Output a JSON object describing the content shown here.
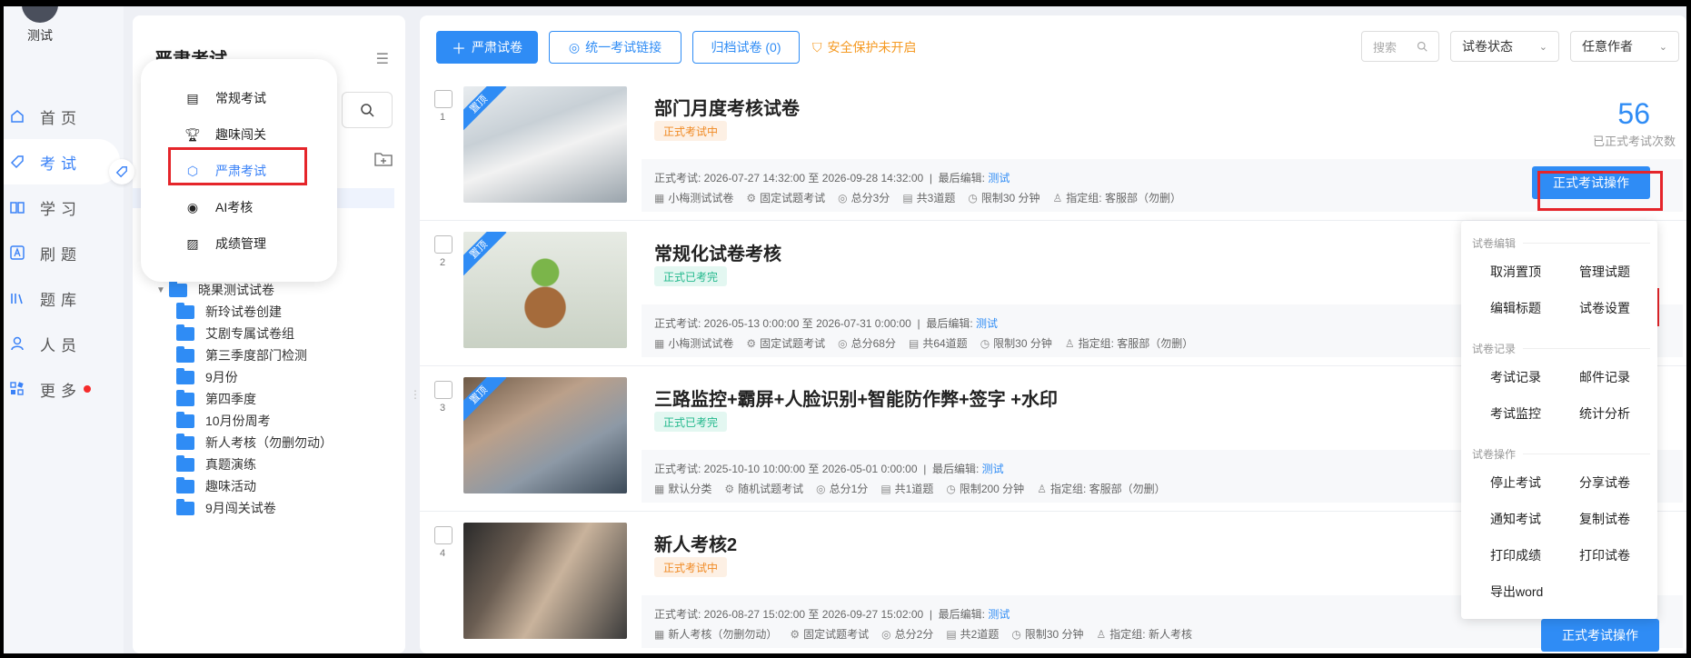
{
  "user": {
    "name": "测试"
  },
  "nav": {
    "items": [
      {
        "key": "home",
        "label": "首页",
        "icon": "home-icon"
      },
      {
        "key": "exam",
        "label": "考试",
        "icon": "tag-icon",
        "active": true
      },
      {
        "key": "study",
        "label": "学习",
        "icon": "book-icon"
      },
      {
        "key": "practice",
        "label": "刷题",
        "icon": "a-box-icon"
      },
      {
        "key": "bank",
        "label": "题库",
        "icon": "library-icon"
      },
      {
        "key": "people",
        "label": "人员",
        "icon": "user-icon"
      },
      {
        "key": "more",
        "label": "更多",
        "icon": "apps-icon",
        "dot": true
      }
    ]
  },
  "folder_panel": {
    "title": "严肃考试",
    "tree": [
      {
        "label": "晓果测试试卷",
        "expanded": true
      },
      {
        "label": "新玲试卷创建"
      },
      {
        "label": "艾剧专属试卷组"
      },
      {
        "label": "第三季度部门检测"
      },
      {
        "label": "9月份"
      },
      {
        "label": "第四季度"
      },
      {
        "label": "10月份周考"
      },
      {
        "label": "新人考核（勿删勿动）"
      },
      {
        "label": "真题演练"
      },
      {
        "label": "趣味活动"
      },
      {
        "label": "9月闯关试卷"
      }
    ]
  },
  "popover": {
    "items": [
      {
        "label": "常规考试",
        "icon": "document-icon"
      },
      {
        "label": "趣味闯关",
        "icon": "trophy-icon"
      },
      {
        "label": "严肃考试",
        "icon": "shield-icon",
        "selected": true
      },
      {
        "label": "AI考核",
        "icon": "ai-icon"
      },
      {
        "label": "成绩管理",
        "icon": "chart-icon"
      }
    ]
  },
  "toolbar": {
    "create_label": "严肃试卷",
    "link_label": "统一考试链接",
    "archive_label": "归档试卷 (0)",
    "safe_tip": "安全保护未开启",
    "search_placeholder": "搜索",
    "status_select": "试卷状态",
    "author_select": "任意作者"
  },
  "exams": [
    {
      "index": "1",
      "ribbon": "置顶",
      "title": "部门月度考核试卷",
      "tag": "正式考试中",
      "tag_color": "orange",
      "schedule": "正式考试:  2026-07-27 14:32:00 至 2026-09-28 14:32:00",
      "editor_label": "最后编辑:",
      "editor": "测试",
      "meta": [
        "小梅测试试卷",
        "固定试题考试",
        "总分3分",
        "共3道题",
        "限制30 分钟",
        "指定组: 客服部（勿删）"
      ],
      "count": "56",
      "count_label": "已正式考试次数",
      "op_label": "正式考试操作"
    },
    {
      "index": "2",
      "ribbon": "置顶",
      "title": "常规化试卷考核",
      "tag": "正式已考完",
      "tag_color": "green",
      "schedule": "正式考试:  2026-05-13 0:00:00 至 2026-07-31 0:00:00",
      "editor_label": "最后编辑:",
      "editor": "测试",
      "meta": [
        "小梅测试试卷",
        "固定试题考试",
        "总分68分",
        "共64道题",
        "限制30 分钟",
        "指定组: 客服部（勿删）"
      ]
    },
    {
      "index": "3",
      "ribbon": "置顶",
      "title": "三路监控+霸屏+人脸识别+智能防作弊+签字 +水印",
      "tag": "正式已考完",
      "tag_color": "green",
      "schedule": "正式考试:  2025-10-10 10:00:00 至 2026-05-01 0:00:00",
      "editor_label": "最后编辑:",
      "editor": "测试",
      "meta": [
        "默认分类",
        "随机试题考试",
        "总分1分",
        "共1道题",
        "限制200 分钟",
        "指定组: 客服部（勿删）"
      ]
    },
    {
      "index": "4",
      "title": "新人考核2",
      "tag": "正式考试中",
      "tag_color": "orange",
      "schedule": "正式考试:  2026-08-27 15:02:00 至 2026-09-27 15:02:00",
      "editor_label": "最后编辑:",
      "editor": "测试",
      "meta": [
        "新人考核（勿删勿动）",
        "固定试题考试",
        "总分2分",
        "共2道题",
        "限制30 分钟",
        "指定组: 新人考核"
      ],
      "op_label": "正式考试操作"
    }
  ],
  "dropdown": {
    "groups": [
      {
        "title": "试卷编辑",
        "items": [
          "取消置顶",
          "管理试题",
          "编辑标题",
          "试卷设置"
        ]
      },
      {
        "title": "试卷记录",
        "items": [
          "考试记录",
          "邮件记录",
          "考试监控",
          "统计分析"
        ]
      },
      {
        "title": "试卷操作",
        "items": [
          "停止考试",
          "分享试卷",
          "通知考试",
          "复制试卷",
          "打印成绩",
          "打印试卷",
          "导出word"
        ]
      }
    ]
  },
  "colors": {
    "primary": "#2f8cf5",
    "highlight_box": "#e5252a",
    "warning": "#f59a23"
  }
}
